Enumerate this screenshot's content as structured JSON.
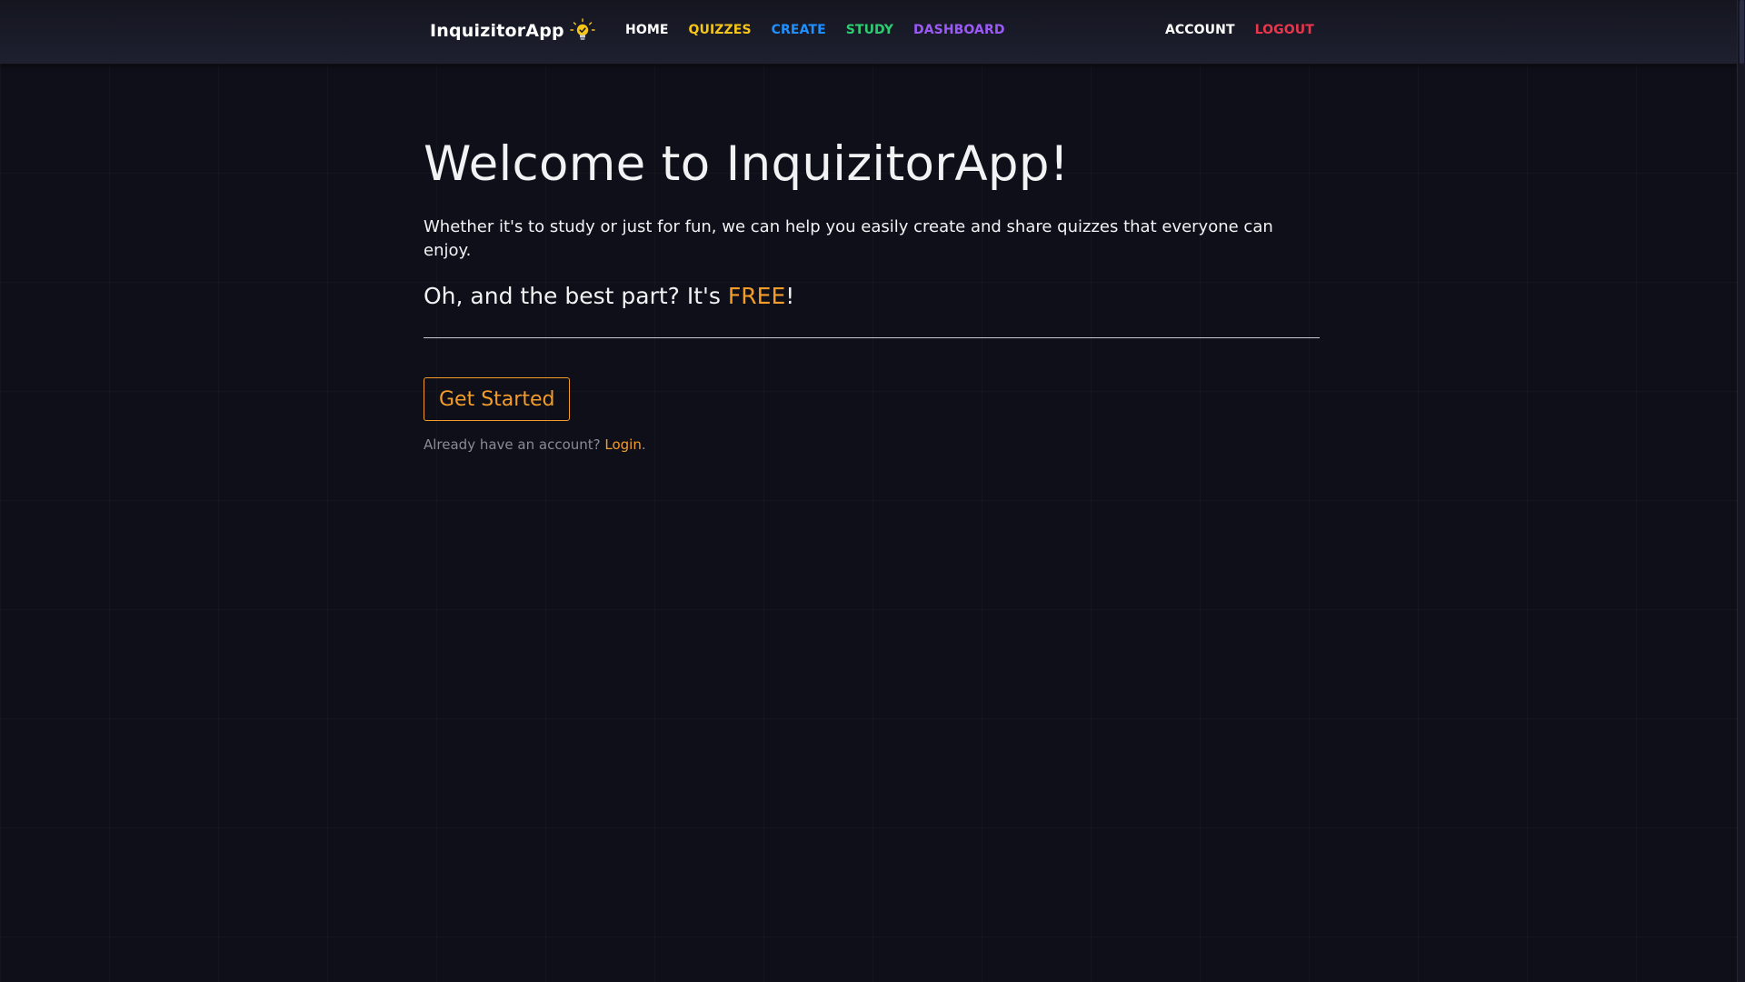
{
  "navbar": {
    "brand": "InquizitorApp",
    "brand_icon": "lightbulb-icon",
    "links": [
      {
        "id": "home",
        "label": "HOME",
        "color": "#ffffff"
      },
      {
        "id": "quizzes",
        "label": "QUIZZES",
        "color": "#f5c518"
      },
      {
        "id": "create",
        "label": "CREATE",
        "color": "#1e90ff"
      },
      {
        "id": "study",
        "label": "STUDY",
        "color": "#2ecc71"
      },
      {
        "id": "dashboard",
        "label": "DASHBOARD",
        "color": "#9b59f6"
      }
    ],
    "account_label": "ACCOUNT",
    "account_color": "#ffffff",
    "logout_label": "LOGOUT",
    "logout_color": "#e8364d"
  },
  "hero": {
    "title": "Welcome to InquizitorApp!",
    "lead": "Whether it's to study or just for fun, we can help you easily create and share quizzes that everyone can enjoy.",
    "sub_prefix": "Oh, and the best part? It's ",
    "sub_highlight": "FREE",
    "sub_suffix": "!",
    "cta_label": "Get Started",
    "login_prompt": "Already have an account? ",
    "login_label": "Login",
    "login_suffix": "."
  },
  "colors": {
    "accent": "#f39c2a",
    "background": "#0e0f18",
    "navbar": "#1a1b28"
  }
}
